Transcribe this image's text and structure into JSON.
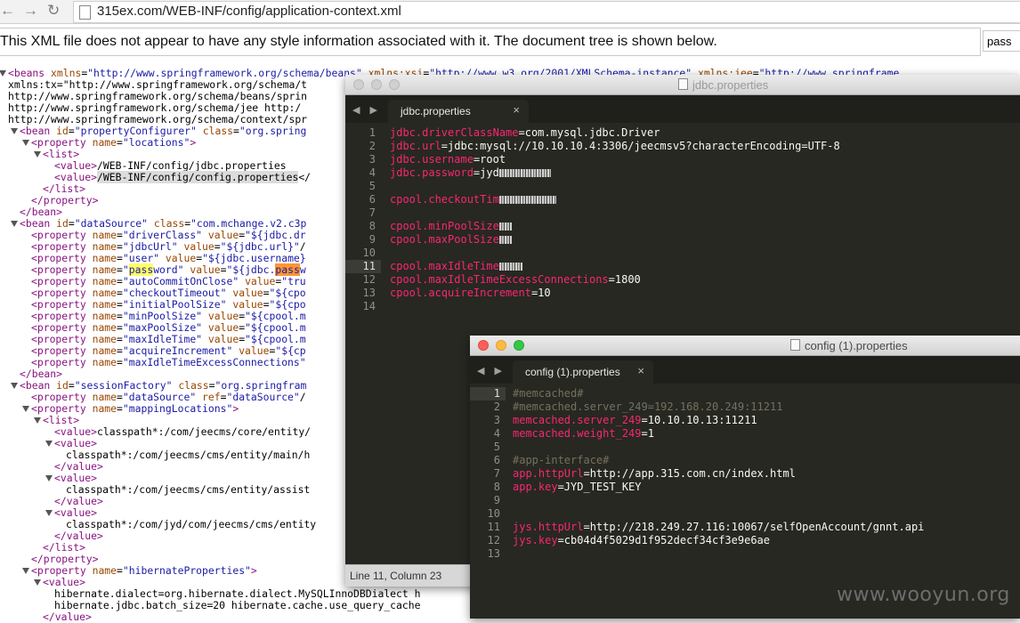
{
  "browser": {
    "url": "315ex.com/WEB-INF/config/application-context.xml",
    "back_glyph": "←",
    "forward_glyph": "→",
    "reload_glyph": "↻",
    "find_value": "pass"
  },
  "xml_info": {
    "message": "This XML file does not appear to have any style information associated with it. The document tree is shown below."
  },
  "xml_lines": [
    "<beans xmlns=\"http://www.springframework.org/schema/beans\" xmlns:xsi=\"http://www.w3.org/2001/XMLSchema-instance\" xmlns:jee=\"http://www.springframe",
    "xmlns:tx=\"http://www.springframework.org/schema/t",
    "http://www.springframework.org/schema/beans/sprin",
    "http://www.springframework.org/schema/jee http:/",
    "http://www.springframework.org/schema/context/spr",
    "<bean id=\"propertyConfigurer\" class=\"org.spring",
    "<property name=\"locations\">",
    "<list>",
    "<value>/WEB-INF/config/jdbc.properties</va",
    "<value>/WEB-INF/config/config.properties</",
    "</list>",
    "</property>",
    "</bean>",
    "<bean id=\"dataSource\" class=\"com.mchange.v2.c3p",
    "<property name=\"driverClass\" value=\"${jdbc.dr",
    "<property name=\"jdbcUrl\" value=\"${jdbc.url}\"/",
    "<property name=\"user\" value=\"${jdbc.username}",
    "<property name=\"password\" value=\"${jdbc.passw",
    "<property name=\"autoCommitOnClose\" value=\"tru",
    "<property name=\"checkoutTimeout\" value=\"${cpo",
    "<property name=\"initialPoolSize\" value=\"${cpo",
    "<property name=\"minPoolSize\" value=\"${cpool.m",
    "<property name=\"maxPoolSize\" value=\"${cpool.m",
    "<property name=\"maxIdleTime\" value=\"${cpool.m",
    "<property name=\"acquireIncrement\" value=\"${cp",
    "<property name=\"maxIdleTimeExcessConnections\"",
    "</bean>",
    "<bean id=\"sessionFactory\" class=\"org.springfram",
    "<property name=\"dataSource\" ref=\"dataSource\"/",
    "<property name=\"mappingLocations\">",
    "<list>",
    "<value>classpath*:/com/jeecms/core/entity/",
    "<value>",
    "classpath*:/com/jeecms/cms/entity/main/h",
    "</value>",
    "<value>",
    "classpath*:/com/jeecms/cms/entity/assist",
    "</value>",
    "<value>",
    "classpath*:/com/jyd/com/jeecms/cms/entity",
    "</value>",
    "</list>",
    "</property>",
    "<property name=\"hibernateProperties\">",
    "<value>",
    "hibernate.dialect=org.hibernate.dialect.MySQLInnoDBDialect h",
    "hibernate.jdbc.batch_size=20 hibernate.cache.use_query_cache",
    "</value>"
  ],
  "jdbc_window": {
    "title": "jdbc.properties",
    "tab_label": "jdbc.properties",
    "close_glyph": "×",
    "nav_glyph": "◀ ▶",
    "line_numbers": [
      "1",
      "2",
      "3",
      "4",
      "5",
      "6",
      "7",
      "8",
      "9",
      "10",
      "11",
      "12",
      "13",
      "14"
    ],
    "current_line": 11,
    "lines": [
      {
        "key": "jdbc.driverClassName",
        "value": "=com.mysql.jdbc.Driver",
        "blur": 0
      },
      {
        "key": "jdbc.url",
        "value": "=jdbc:mysql://10.10.10.4:3306/jeecmsv5?characterEncoding=UTF-8",
        "blur": 0
      },
      {
        "key": "jdbc.username",
        "value": "=root",
        "blur": 0
      },
      {
        "key": "jdbc.password",
        "value": "=jyd",
        "blur": 58
      },
      {
        "key": "",
        "value": "",
        "blur": 0
      },
      {
        "key": "cpool.checkoutTim",
        "value": "",
        "blur": 64
      },
      {
        "key": "",
        "value": "",
        "blur": 0
      },
      {
        "key": "cpool.minPoolSize",
        "value": "",
        "blur": 14
      },
      {
        "key": "cpool.maxPoolSize",
        "value": "",
        "blur": 14
      },
      {
        "key": "",
        "value": "",
        "blur": 0
      },
      {
        "key": "cpool.maxIdleTime",
        "value": "",
        "blur": 26
      },
      {
        "key": "cpool.maxIdleTimeExcessConnections",
        "value": "=1800",
        "blur": 0
      },
      {
        "key": "cpool.acquireIncrement",
        "value": "=10",
        "blur": 0
      },
      {
        "key": "",
        "value": "",
        "blur": 0
      }
    ],
    "status": "Line 11, Column 23"
  },
  "config_window": {
    "title": "config (1).properties",
    "tab_label": "config (1).properties",
    "close_glyph": "×",
    "nav_glyph": "◀ ▶",
    "line_numbers": [
      "1",
      "2",
      "3",
      "4",
      "5",
      "6",
      "7",
      "8",
      "9",
      "10",
      "11",
      "12",
      "13"
    ],
    "current_line": 1,
    "lines": [
      {
        "comment": "#memcached#",
        "key": "",
        "value": ""
      },
      {
        "comment": "#memcached.server_249=192.168.20.249:11211",
        "key": "",
        "value": ""
      },
      {
        "comment": "",
        "key": "memcached.server_249",
        "value": "=10.10.10.13:11211"
      },
      {
        "comment": "",
        "key": "memcached.weight_249",
        "value": "=1"
      },
      {
        "comment": "",
        "key": "",
        "value": ""
      },
      {
        "comment": "#app-interface#",
        "key": "",
        "value": ""
      },
      {
        "comment": "",
        "key": "app.httpUrl",
        "value": "=http://app.315.com.cn/index.html"
      },
      {
        "comment": "",
        "key": "app.key",
        "value": "=JYD_TEST_KEY"
      },
      {
        "comment": "",
        "key": "",
        "value": ""
      },
      {
        "comment": "",
        "key": "",
        "value": ""
      },
      {
        "comment": "",
        "key": "jys.httpUrl",
        "value": "=http://218.249.27.116:10067/selfOpenAccount/gnnt.api"
      },
      {
        "comment": "",
        "key": "jys.key",
        "value": "=cb04d4f5029d1f952decf34cf3e9e6ae"
      },
      {
        "comment": "",
        "key": "",
        "value": ""
      }
    ]
  },
  "watermark": "www.wooyun.org",
  "colors": {
    "editor_bg": "#272822",
    "key_pink": "#f92672",
    "comment": "#75715e",
    "xml_tag": "#881280",
    "xml_attr": "#994500",
    "xml_value": "#1a1aa6"
  }
}
